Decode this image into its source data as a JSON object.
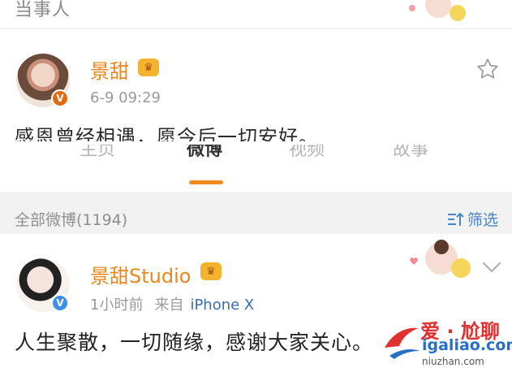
{
  "top_card": {
    "label": "当事人"
  },
  "post1": {
    "author": "景甜",
    "timestamp": "6-9 09:29",
    "text": "感恩曾经相遇，愿今后一切安好。"
  },
  "tabs": [
    {
      "label": "主页"
    },
    {
      "label": "微博"
    },
    {
      "label": "视频"
    },
    {
      "label": "故事"
    }
  ],
  "section": {
    "title": "全部微博(1194)",
    "filter_label": "筛选"
  },
  "post2": {
    "author": "景甜Studio",
    "time": "1小时前",
    "source_prefix": "来自",
    "device": "iPhone X",
    "text": "人生聚散，一切随缘，感谢大家关心。"
  },
  "watermark": {
    "line1": "爱 · 尬聊",
    "line2": "igaliao.com",
    "line3": "niuzhan.com"
  },
  "colors": {
    "accent_orange": "#f08a24",
    "name_orange": "#e9871e",
    "link_blue": "#3b6ea8"
  }
}
